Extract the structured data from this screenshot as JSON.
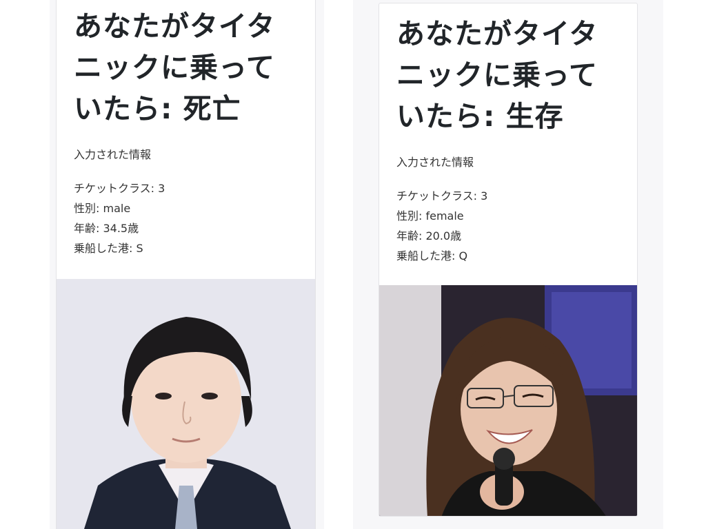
{
  "cards": [
    {
      "title": "あなたがタイタニックに乗っていたら: 死亡",
      "info_heading": "入力された情報",
      "info": [
        "チケットクラス: 3",
        "性別: male",
        "年齢: 34.5歳",
        "乗船した港: S"
      ],
      "photo_icon": "person-photo-man"
    },
    {
      "title": "あなたがタイタニックに乗っていたら: 生存",
      "info_heading": "入力された情報",
      "info": [
        "チケットクラス: 3",
        "性別: female",
        "年齢: 20.0歳",
        "乗船した港: Q"
      ],
      "photo_icon": "person-photo-woman"
    }
  ],
  "colors": {
    "background": "#f7f7f9",
    "card": "#ffffff",
    "text": "#212529"
  }
}
